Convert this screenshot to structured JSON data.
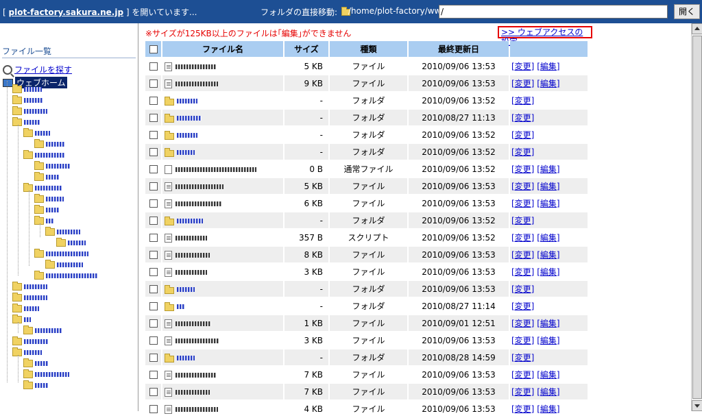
{
  "header": {
    "bracket_open": "[ ",
    "host_link": "plot-factory.sakura.ne.jp",
    "bracket_close": " ] を開いています...",
    "jump_label": "フォルダの直接移動:",
    "current_path": "/home/plot-factory/www",
    "path_input_value": "/",
    "open_button": "開く"
  },
  "sidebar": {
    "title": "ファイル一覧",
    "find_link": "ファイルを探す",
    "home_link": "ウェブホーム"
  },
  "main": {
    "warning": "※サイズが125KB以上のファイルは｢編集｣ができません",
    "web_access_button": ">> ウェブアクセスの設定"
  },
  "table": {
    "headers": {
      "name": "ファイル名",
      "size": "サイズ",
      "type": "種類",
      "date": "最終更新日"
    },
    "change_label": "[変更]",
    "edit_label": "[編集]",
    "rows": [
      {
        "kind": "file",
        "size": "5 KB",
        "type": "ファイル",
        "date": "2010/09/06 13:53"
      },
      {
        "kind": "file",
        "size": "9 KB",
        "type": "ファイル",
        "date": "2010/09/06 13:53"
      },
      {
        "kind": "folder",
        "size": "-",
        "type": "フォルダ",
        "date": "2010/09/06 13:52"
      },
      {
        "kind": "folder",
        "size": "-",
        "type": "フォルダ",
        "date": "2010/08/27 11:13"
      },
      {
        "kind": "folder",
        "size": "-",
        "type": "フォルダ",
        "date": "2010/09/06 13:52"
      },
      {
        "kind": "folder",
        "size": "-",
        "type": "フォルダ",
        "date": "2010/09/06 13:52"
      },
      {
        "kind": "plain",
        "size": "0 B",
        "type": "通常ファイル",
        "date": "2010/09/06 13:52"
      },
      {
        "kind": "file",
        "size": "5 KB",
        "type": "ファイル",
        "date": "2010/09/06 13:53"
      },
      {
        "kind": "file",
        "size": "6 KB",
        "type": "ファイル",
        "date": "2010/09/06 13:53"
      },
      {
        "kind": "folder",
        "size": "-",
        "type": "フォルダ",
        "date": "2010/09/06 13:52"
      },
      {
        "kind": "file",
        "size": "357 B",
        "type": "スクリプト",
        "date": "2010/09/06 13:52"
      },
      {
        "kind": "file",
        "size": "8 KB",
        "type": "ファイル",
        "date": "2010/09/06 13:53"
      },
      {
        "kind": "file",
        "size": "3 KB",
        "type": "ファイル",
        "date": "2010/09/06 13:53"
      },
      {
        "kind": "folder",
        "size": "-",
        "type": "フォルダ",
        "date": "2010/09/06 13:53"
      },
      {
        "kind": "folder",
        "size": "-",
        "type": "フォルダ",
        "date": "2010/08/27 11:14"
      },
      {
        "kind": "file",
        "size": "1 KB",
        "type": "ファイル",
        "date": "2010/09/01 12:51"
      },
      {
        "kind": "file",
        "size": "3 KB",
        "type": "ファイル",
        "date": "2010/09/06 13:53"
      },
      {
        "kind": "folder",
        "size": "-",
        "type": "フォルダ",
        "date": "2010/08/28 14:59"
      },
      {
        "kind": "file",
        "size": "7 KB",
        "type": "ファイル",
        "date": "2010/09/06 13:53"
      },
      {
        "kind": "file",
        "size": "7 KB",
        "type": "ファイル",
        "date": "2010/09/06 13:53"
      },
      {
        "kind": "file",
        "size": "4 KB",
        "type": "ファイル",
        "date": "2010/09/06 13:53"
      }
    ]
  },
  "colors": {
    "header_bg": "#1d4f94",
    "table_header": "#aacdf1",
    "warning": "#e60000",
    "link": "#0000cc"
  }
}
